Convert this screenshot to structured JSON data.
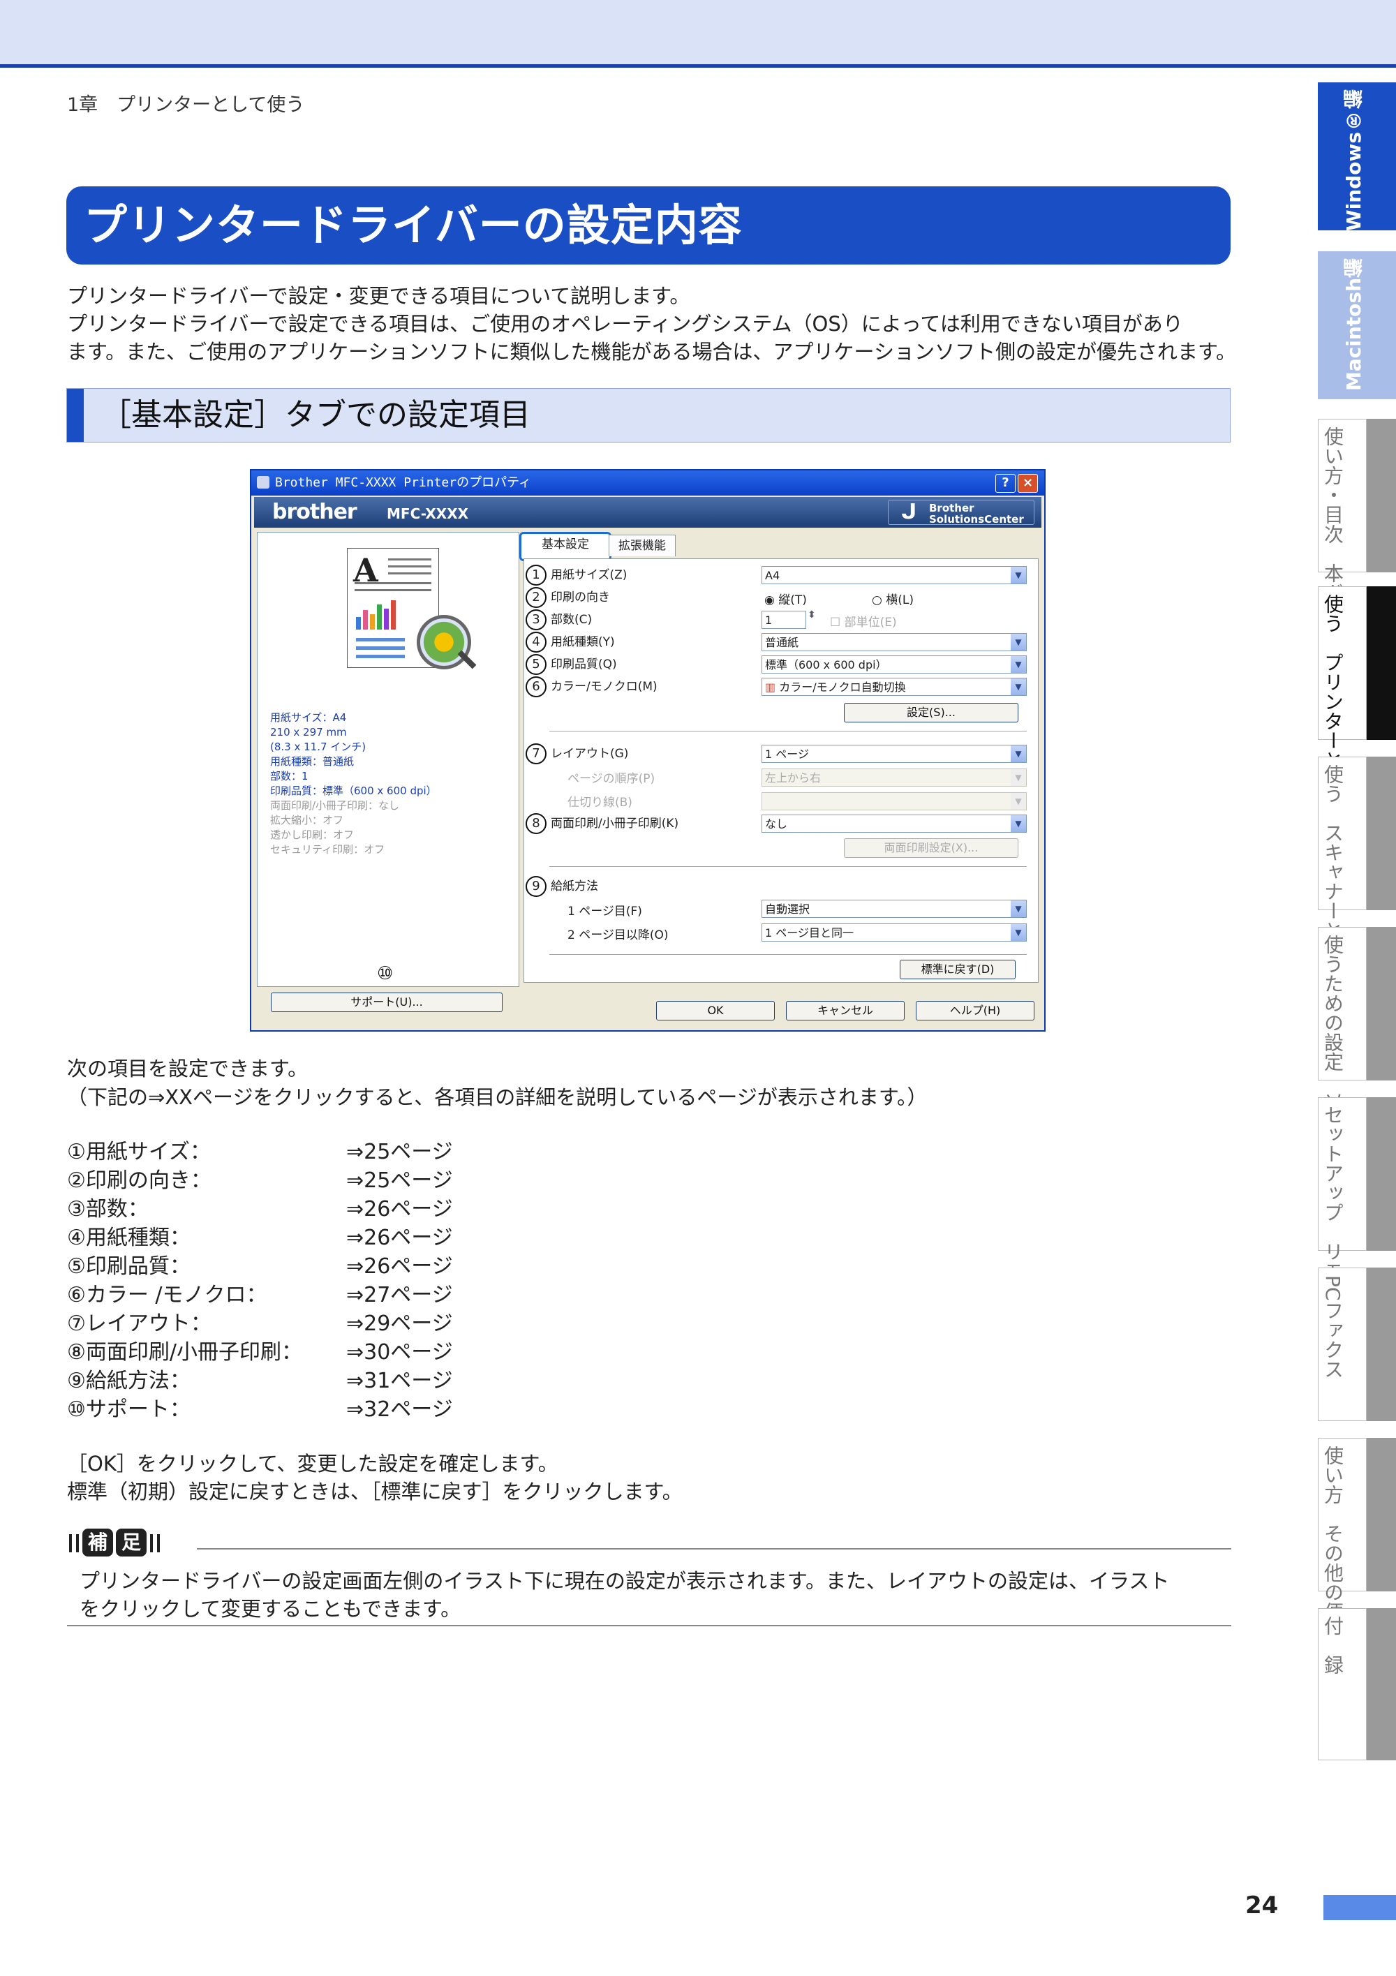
{
  "header": {
    "chapter": "1章　プリンターとして使う"
  },
  "title": "プリンタードライバーの設定内容",
  "intro": [
    "プリンタードライバーで設定・変更できる項目について説明します。",
    "プリンタードライバーで設定できる項目は、ご使用のオペレーティングシステム（OS）によっては利用できない項目があり",
    "ます。また、ご使用のアプリケーションソフトに類似した機能がある場合は、アプリケーションソフト側の設定が優先されます。"
  ],
  "section_title": "［基本設定］タブでの設定項目",
  "dialog": {
    "title": "Brother MFC-XXXX Printerのプロパティ",
    "help_btn": "?",
    "close_btn": "×",
    "brand": "brother",
    "model": "MFC-XXXX",
    "solutions_center": [
      "Brother",
      "SolutionsCenter"
    ],
    "preview_letter": "A",
    "settings_lines": [
      "用紙サイズ：A4",
      "210 x 297 mm",
      "(8.3 x 11.7 インチ)",
      "用紙種類：普通紙",
      "部数：1",
      "印刷品質：標準（600 x 600 dpi）",
      "両面印刷/小冊子印刷：なし",
      "拡大縮小：オフ",
      "透かし印刷：オフ",
      "セキュリティ印刷：オフ"
    ],
    "num10": "⑩",
    "support_btn": "サポート(U)...",
    "tabs": [
      "基本設定",
      "拡張機能"
    ],
    "rows": {
      "paper_size": {
        "num": "1",
        "label": "用紙サイズ(Z)",
        "value": "A4"
      },
      "orientation": {
        "num": "2",
        "label": "印刷の向き",
        "portrait": "縦(T)",
        "landscape": "横(L)"
      },
      "copies": {
        "num": "3",
        "label": "部数(C)",
        "value": "1",
        "collate": "部単位(E)"
      },
      "media": {
        "num": "4",
        "label": "用紙種類(Y)",
        "value": "普通紙"
      },
      "quality": {
        "num": "5",
        "label": "印刷品質(Q)",
        "value": "標準（600 x 600 dpi）"
      },
      "color": {
        "num": "6",
        "label": "カラー/モノクロ(M)",
        "value": "カラー/モノクロ自動切換"
      },
      "settings_btn": "設定(S)...",
      "layout": {
        "num": "7",
        "label": "レイアウト(G)",
        "value": "1 ページ"
      },
      "page_order": {
        "label": "ページの順序(P)",
        "value": "左上から右"
      },
      "border": {
        "label": "仕切り線(B)"
      },
      "duplex": {
        "num": "8",
        "label": "両面印刷/小冊子印刷(K)",
        "value": "なし"
      },
      "duplex_btn": "両面印刷設定(X)...",
      "source": {
        "num": "9",
        "label": "給紙方法"
      },
      "first_page": {
        "label": "1 ページ目(F)",
        "value": "自動選択"
      },
      "other_pages": {
        "label": "2 ページ目以降(O)",
        "value": "1 ページ目と同一"
      },
      "default_btn": "標準に戻す(D)"
    },
    "ok": "OK",
    "cancel": "キャンセル",
    "help": "ヘルプ(H)"
  },
  "body": {
    "line1": "次の項目を設定できます。",
    "line2": "（下記の⇒XXページをクリックすると、各項目の詳細を説明しているページが表示されます。）",
    "items": [
      {
        "name": "①用紙サイズ：",
        "page": "⇒25ページ"
      },
      {
        "name": "②印刷の向き：",
        "page": "⇒25ページ"
      },
      {
        "name": "③部数：",
        "page": "⇒26ページ"
      },
      {
        "name": "④用紙種類：",
        "page": "⇒26ページ"
      },
      {
        "name": "⑤印刷品質：",
        "page": "⇒26ページ"
      },
      {
        "name": "⑥カラー /モノクロ：",
        "page": "⇒27ページ"
      },
      {
        "name": "⑦レイアウト：",
        "page": "⇒29ページ"
      },
      {
        "name": "⑧両面印刷/小冊子印刷：",
        "page": "⇒30ページ"
      },
      {
        "name": "⑨給紙方法：",
        "page": "⇒31ページ"
      },
      {
        "name": "⑩サポート：",
        "page": "⇒32ページ"
      }
    ],
    "ok_text": "［OK］をクリックして、変更した設定を確定します。",
    "reset_text": "標準（初期）設定に戻すときは、［標準に戻す］をクリックします。"
  },
  "note": {
    "label": [
      "補",
      "足"
    ],
    "lines": [
      "プリンタードライバーの設定画面左側のイラスト下に現在の設定が表示されます。また、レイアウトの設定は、イラスト",
      "をクリックして変更することもできます。"
    ]
  },
  "side_tabs": [
    "Windows®編",
    "Macintosh編",
    "使い方・目次　本ガイドの",
    "使う　プリンターとして",
    "使う　スキャナーとして",
    "使うための設定　ソフトウェアを",
    "セットアップ　リモート",
    "PCファクス",
    "使い方　その他の便利な",
    "付　録"
  ],
  "page_number": "24",
  "colors": {
    "accent": "#1a4ec4",
    "band": "#d9e2f7"
  }
}
